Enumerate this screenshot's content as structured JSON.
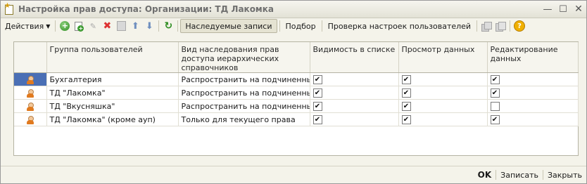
{
  "window": {
    "title": "Настройка прав доступа: Организации: ТД Лакомка",
    "controls": {
      "minimize": "—",
      "maximize": "☐",
      "close": "✕"
    }
  },
  "toolbar": {
    "actions_label": "Действия",
    "inherited_label": "Наследуемые записи",
    "selection_label": "Подбор",
    "check_label": "Проверка настроек пользователей"
  },
  "table": {
    "columns": [
      "",
      "Группа пользователей",
      "Вид наследования прав доступа иерархических справочников",
      "Видимость в списке",
      "Просмотр данных",
      "Редактирование данных"
    ],
    "rows": [
      {
        "icon": "user-group-icon",
        "group": "Бухгалтерия",
        "inherit": "Распространить на подчиненных",
        "visible": true,
        "view": true,
        "edit": true
      },
      {
        "icon": "user-icon",
        "group": "ТД \"Лакомка\"",
        "inherit": "Распространить на подчиненных",
        "visible": true,
        "view": true,
        "edit": true
      },
      {
        "icon": "user-icon",
        "group": "ТД \"Вкусняшка\"",
        "inherit": "Распространить на подчиненных",
        "visible": true,
        "view": true,
        "edit": false
      },
      {
        "icon": "user-icon",
        "group": "ТД \"Лакомка\" (кроме ауп)",
        "inherit": "Только для текущего права",
        "visible": true,
        "view": true,
        "edit": true
      }
    ]
  },
  "footer": {
    "ok_label": "OK",
    "save_label": "Записать",
    "close_label": "Закрыть"
  }
}
